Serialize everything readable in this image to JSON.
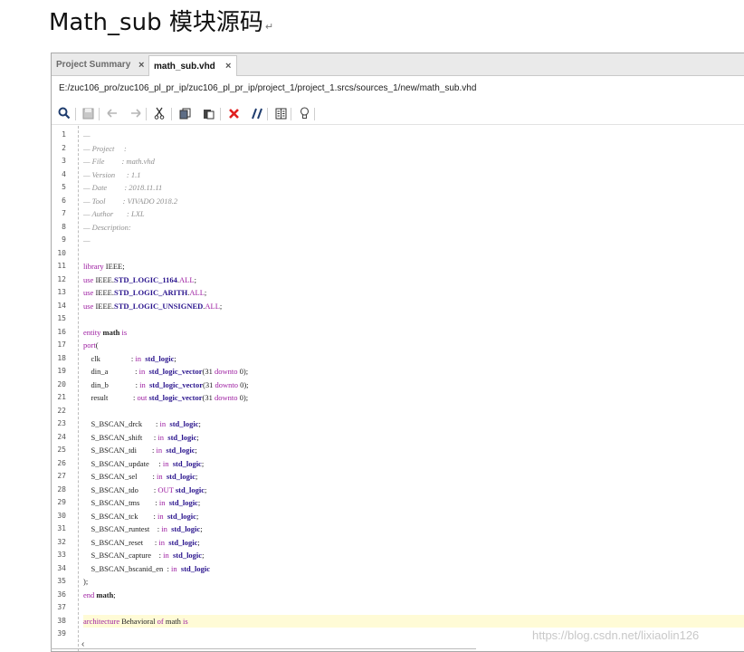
{
  "heading": {
    "text": "Math_sub 模块源码",
    "mark": "↵"
  },
  "tabs": [
    {
      "label": "Project Summary",
      "close": "×",
      "active": false
    },
    {
      "label": "math_sub.vhd",
      "close": "×",
      "active": true
    }
  ],
  "file_path": "E:/zuc106_pro/zuc106_pl_pr_ip/zuc106_pl_pr_ip/project_1/project_1.srcs/sources_1/new/math_sub.vhd",
  "toolbar": {
    "icons": [
      "search-icon",
      "save-icon",
      "undo-icon",
      "redo-icon",
      "cut-icon",
      "copy-icon",
      "paste-icon",
      "delete-icon",
      "comment-icon",
      "toggle-columns-icon",
      "lightbulb-icon"
    ],
    "delete_color": "#e02020"
  },
  "highlight_line": 38,
  "colors": {
    "keyword": "#9d1da1",
    "type": "#2a148d",
    "comment": "#909090",
    "highlight": "#fffbd6"
  },
  "code": [
    [
      [
        "cm",
        "—"
      ]
    ],
    [
      [
        "cm",
        "— Project     :"
      ]
    ],
    [
      [
        "cm",
        "— File         : math.vhd"
      ]
    ],
    [
      [
        "cm",
        "— Version      : 1.1"
      ]
    ],
    [
      [
        "cm",
        "— Date         : 2018.11.11"
      ]
    ],
    [
      [
        "cm",
        "— Tool         : VIVADO 2018.2"
      ]
    ],
    [
      [
        "cm",
        "— Author       : LXL"
      ]
    ],
    [
      [
        "cm",
        "— Description:"
      ]
    ],
    [
      [
        "cm",
        "—"
      ]
    ],
    [],
    [
      [
        "kw",
        "library"
      ],
      [
        "id",
        " IEEE;"
      ]
    ],
    [
      [
        "kw",
        "use"
      ],
      [
        "id",
        " IEEE."
      ],
      [
        "ty",
        "STD_LOGIC_1164"
      ],
      [
        "id",
        "."
      ],
      [
        "kw",
        "ALL"
      ],
      [
        "id",
        ";"
      ]
    ],
    [
      [
        "kw",
        "use"
      ],
      [
        "id",
        " IEEE."
      ],
      [
        "ty",
        "STD_LOGIC_ARITH"
      ],
      [
        "id",
        "."
      ],
      [
        "kw",
        "ALL"
      ],
      [
        "id",
        ";"
      ]
    ],
    [
      [
        "kw",
        "use"
      ],
      [
        "id",
        " IEEE."
      ],
      [
        "ty",
        "STD_LOGIC_UNSIGNED"
      ],
      [
        "id",
        "."
      ],
      [
        "kw",
        "ALL"
      ],
      [
        "id",
        ";"
      ]
    ],
    [],
    [
      [
        "kw",
        "entity"
      ],
      [
        "bd",
        " math "
      ],
      [
        "kw",
        "is"
      ]
    ],
    [
      [
        "kw",
        "port"
      ],
      [
        "id",
        "("
      ]
    ],
    [
      [
        "id",
        "    clk                : "
      ],
      [
        "kw",
        "in"
      ],
      [
        "id",
        "  "
      ],
      [
        "ty",
        "std_logic"
      ],
      [
        "id",
        ";"
      ]
    ],
    [
      [
        "id",
        "    din_a              : "
      ],
      [
        "kw",
        "in"
      ],
      [
        "id",
        "  "
      ],
      [
        "ty",
        "std_logic_vector"
      ],
      [
        "id",
        "(31 "
      ],
      [
        "kw",
        "downto"
      ],
      [
        "id",
        " 0);"
      ]
    ],
    [
      [
        "id",
        "    din_b              : "
      ],
      [
        "kw",
        "in"
      ],
      [
        "id",
        "  "
      ],
      [
        "ty",
        "std_logic_vector"
      ],
      [
        "id",
        "(31 "
      ],
      [
        "kw",
        "downto"
      ],
      [
        "id",
        " 0);"
      ]
    ],
    [
      [
        "id",
        "    result             : "
      ],
      [
        "kw",
        "out"
      ],
      [
        "id",
        " "
      ],
      [
        "ty",
        "std_logic_vector"
      ],
      [
        "id",
        "(31 "
      ],
      [
        "kw",
        "downto"
      ],
      [
        "id",
        " 0);"
      ]
    ],
    [],
    [
      [
        "id",
        "    S_BSCAN_drck       : "
      ],
      [
        "kw",
        "in"
      ],
      [
        "id",
        "  "
      ],
      [
        "ty",
        "std_logic"
      ],
      [
        "id",
        ";"
      ]
    ],
    [
      [
        "id",
        "    S_BSCAN_shift      : "
      ],
      [
        "kw",
        "in"
      ],
      [
        "id",
        "  "
      ],
      [
        "ty",
        "std_logic"
      ],
      [
        "id",
        ";"
      ]
    ],
    [
      [
        "id",
        "    S_BSCAN_tdi        : "
      ],
      [
        "kw",
        "in"
      ],
      [
        "id",
        "  "
      ],
      [
        "ty",
        "std_logic"
      ],
      [
        "id",
        ";"
      ]
    ],
    [
      [
        "id",
        "    S_BSCAN_update     : "
      ],
      [
        "kw",
        "in"
      ],
      [
        "id",
        "  "
      ],
      [
        "ty",
        "std_logic"
      ],
      [
        "id",
        ";"
      ]
    ],
    [
      [
        "id",
        "    S_BSCAN_sel        : "
      ],
      [
        "kw",
        "in"
      ],
      [
        "id",
        "  "
      ],
      [
        "ty",
        "std_logic"
      ],
      [
        "id",
        ";"
      ]
    ],
    [
      [
        "id",
        "    S_BSCAN_tdo        : "
      ],
      [
        "kw",
        "OUT"
      ],
      [
        "id",
        " "
      ],
      [
        "ty",
        "std_logic"
      ],
      [
        "id",
        ";"
      ]
    ],
    [
      [
        "id",
        "    S_BSCAN_tms        : "
      ],
      [
        "kw",
        "in"
      ],
      [
        "id",
        "  "
      ],
      [
        "ty",
        "std_logic"
      ],
      [
        "id",
        ";"
      ]
    ],
    [
      [
        "id",
        "    S_BSCAN_tck        : "
      ],
      [
        "kw",
        "in"
      ],
      [
        "id",
        "  "
      ],
      [
        "ty",
        "std_logic"
      ],
      [
        "id",
        ";"
      ]
    ],
    [
      [
        "id",
        "    S_BSCAN_runtest    : "
      ],
      [
        "kw",
        "in"
      ],
      [
        "id",
        "  "
      ],
      [
        "ty",
        "std_logic"
      ],
      [
        "id",
        ";"
      ]
    ],
    [
      [
        "id",
        "    S_BSCAN_reset      : "
      ],
      [
        "kw",
        "in"
      ],
      [
        "id",
        "  "
      ],
      [
        "ty",
        "std_logic"
      ],
      [
        "id",
        ";"
      ]
    ],
    [
      [
        "id",
        "    S_BSCAN_capture    : "
      ],
      [
        "kw",
        "in"
      ],
      [
        "id",
        "  "
      ],
      [
        "ty",
        "std_logic"
      ],
      [
        "id",
        ";"
      ]
    ],
    [
      [
        "id",
        "    S_BSCAN_bscanid_en  : "
      ],
      [
        "kw",
        "in"
      ],
      [
        "id",
        "  "
      ],
      [
        "ty",
        "std_logic"
      ]
    ],
    [
      [
        "id",
        ");"
      ]
    ],
    [
      [
        "kw",
        "end"
      ],
      [
        "bd",
        " math"
      ],
      [
        "id",
        ";"
      ]
    ],
    [],
    [
      [
        "kw",
        "architecture"
      ],
      [
        "id",
        " Behavioral "
      ],
      [
        "kw",
        "of"
      ],
      [
        "id",
        " math "
      ],
      [
        "kw",
        "is"
      ]
    ],
    []
  ],
  "scroll_left": "‹",
  "watermark": "https://blog.csdn.net/lixiaolin126"
}
